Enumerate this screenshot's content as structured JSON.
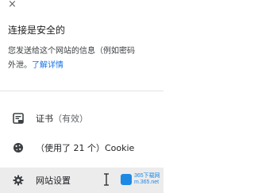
{
  "header": {
    "close_glyph": "×",
    "title": "连接是安全的",
    "description_line1": "您发送给这个网站的信息（例如密码",
    "description_line2_prefix": "外泄。",
    "learn_more_link": "了解详情"
  },
  "rows": {
    "certificate": {
      "icon": "certificate-icon",
      "label": "证书",
      "status": "（有效）"
    },
    "cookies": {
      "icon": "cookie-icon",
      "label": "（使用了 21 个）Cookie"
    },
    "site_settings": {
      "icon": "gear-icon",
      "label": "网站设置"
    }
  },
  "watermark": {
    "line1": "365下载网",
    "line2": "m.365.net"
  },
  "colors": {
    "link": "#1a73e8",
    "hover_row": "#ececec",
    "watermark": "#1e88e5"
  }
}
